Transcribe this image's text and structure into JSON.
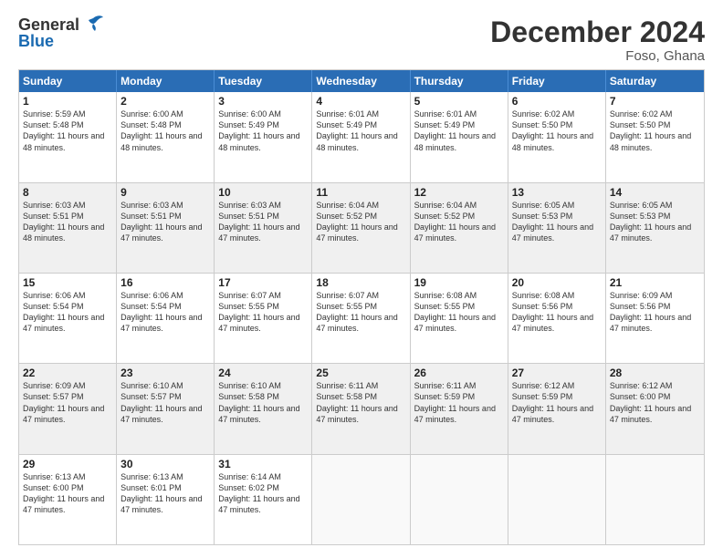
{
  "header": {
    "logo_general": "General",
    "logo_blue": "Blue",
    "month_title": "December 2024",
    "location": "Foso, Ghana"
  },
  "days_of_week": [
    "Sunday",
    "Monday",
    "Tuesday",
    "Wednesday",
    "Thursday",
    "Friday",
    "Saturday"
  ],
  "weeks": [
    [
      {
        "day": "1",
        "sunrise": "Sunrise: 5:59 AM",
        "sunset": "Sunset: 5:48 PM",
        "daylight": "Daylight: 11 hours and 48 minutes."
      },
      {
        "day": "2",
        "sunrise": "Sunrise: 6:00 AM",
        "sunset": "Sunset: 5:48 PM",
        "daylight": "Daylight: 11 hours and 48 minutes."
      },
      {
        "day": "3",
        "sunrise": "Sunrise: 6:00 AM",
        "sunset": "Sunset: 5:49 PM",
        "daylight": "Daylight: 11 hours and 48 minutes."
      },
      {
        "day": "4",
        "sunrise": "Sunrise: 6:01 AM",
        "sunset": "Sunset: 5:49 PM",
        "daylight": "Daylight: 11 hours and 48 minutes."
      },
      {
        "day": "5",
        "sunrise": "Sunrise: 6:01 AM",
        "sunset": "Sunset: 5:49 PM",
        "daylight": "Daylight: 11 hours and 48 minutes."
      },
      {
        "day": "6",
        "sunrise": "Sunrise: 6:02 AM",
        "sunset": "Sunset: 5:50 PM",
        "daylight": "Daylight: 11 hours and 48 minutes."
      },
      {
        "day": "7",
        "sunrise": "Sunrise: 6:02 AM",
        "sunset": "Sunset: 5:50 PM",
        "daylight": "Daylight: 11 hours and 48 minutes."
      }
    ],
    [
      {
        "day": "8",
        "sunrise": "Sunrise: 6:03 AM",
        "sunset": "Sunset: 5:51 PM",
        "daylight": "Daylight: 11 hours and 48 minutes."
      },
      {
        "day": "9",
        "sunrise": "Sunrise: 6:03 AM",
        "sunset": "Sunset: 5:51 PM",
        "daylight": "Daylight: 11 hours and 47 minutes."
      },
      {
        "day": "10",
        "sunrise": "Sunrise: 6:03 AM",
        "sunset": "Sunset: 5:51 PM",
        "daylight": "Daylight: 11 hours and 47 minutes."
      },
      {
        "day": "11",
        "sunrise": "Sunrise: 6:04 AM",
        "sunset": "Sunset: 5:52 PM",
        "daylight": "Daylight: 11 hours and 47 minutes."
      },
      {
        "day": "12",
        "sunrise": "Sunrise: 6:04 AM",
        "sunset": "Sunset: 5:52 PM",
        "daylight": "Daylight: 11 hours and 47 minutes."
      },
      {
        "day": "13",
        "sunrise": "Sunrise: 6:05 AM",
        "sunset": "Sunset: 5:53 PM",
        "daylight": "Daylight: 11 hours and 47 minutes."
      },
      {
        "day": "14",
        "sunrise": "Sunrise: 6:05 AM",
        "sunset": "Sunset: 5:53 PM",
        "daylight": "Daylight: 11 hours and 47 minutes."
      }
    ],
    [
      {
        "day": "15",
        "sunrise": "Sunrise: 6:06 AM",
        "sunset": "Sunset: 5:54 PM",
        "daylight": "Daylight: 11 hours and 47 minutes."
      },
      {
        "day": "16",
        "sunrise": "Sunrise: 6:06 AM",
        "sunset": "Sunset: 5:54 PM",
        "daylight": "Daylight: 11 hours and 47 minutes."
      },
      {
        "day": "17",
        "sunrise": "Sunrise: 6:07 AM",
        "sunset": "Sunset: 5:55 PM",
        "daylight": "Daylight: 11 hours and 47 minutes."
      },
      {
        "day": "18",
        "sunrise": "Sunrise: 6:07 AM",
        "sunset": "Sunset: 5:55 PM",
        "daylight": "Daylight: 11 hours and 47 minutes."
      },
      {
        "day": "19",
        "sunrise": "Sunrise: 6:08 AM",
        "sunset": "Sunset: 5:55 PM",
        "daylight": "Daylight: 11 hours and 47 minutes."
      },
      {
        "day": "20",
        "sunrise": "Sunrise: 6:08 AM",
        "sunset": "Sunset: 5:56 PM",
        "daylight": "Daylight: 11 hours and 47 minutes."
      },
      {
        "day": "21",
        "sunrise": "Sunrise: 6:09 AM",
        "sunset": "Sunset: 5:56 PM",
        "daylight": "Daylight: 11 hours and 47 minutes."
      }
    ],
    [
      {
        "day": "22",
        "sunrise": "Sunrise: 6:09 AM",
        "sunset": "Sunset: 5:57 PM",
        "daylight": "Daylight: 11 hours and 47 minutes."
      },
      {
        "day": "23",
        "sunrise": "Sunrise: 6:10 AM",
        "sunset": "Sunset: 5:57 PM",
        "daylight": "Daylight: 11 hours and 47 minutes."
      },
      {
        "day": "24",
        "sunrise": "Sunrise: 6:10 AM",
        "sunset": "Sunset: 5:58 PM",
        "daylight": "Daylight: 11 hours and 47 minutes."
      },
      {
        "day": "25",
        "sunrise": "Sunrise: 6:11 AM",
        "sunset": "Sunset: 5:58 PM",
        "daylight": "Daylight: 11 hours and 47 minutes."
      },
      {
        "day": "26",
        "sunrise": "Sunrise: 6:11 AM",
        "sunset": "Sunset: 5:59 PM",
        "daylight": "Daylight: 11 hours and 47 minutes."
      },
      {
        "day": "27",
        "sunrise": "Sunrise: 6:12 AM",
        "sunset": "Sunset: 5:59 PM",
        "daylight": "Daylight: 11 hours and 47 minutes."
      },
      {
        "day": "28",
        "sunrise": "Sunrise: 6:12 AM",
        "sunset": "Sunset: 6:00 PM",
        "daylight": "Daylight: 11 hours and 47 minutes."
      }
    ],
    [
      {
        "day": "29",
        "sunrise": "Sunrise: 6:13 AM",
        "sunset": "Sunset: 6:00 PM",
        "daylight": "Daylight: 11 hours and 47 minutes."
      },
      {
        "day": "30",
        "sunrise": "Sunrise: 6:13 AM",
        "sunset": "Sunset: 6:01 PM",
        "daylight": "Daylight: 11 hours and 47 minutes."
      },
      {
        "day": "31",
        "sunrise": "Sunrise: 6:14 AM",
        "sunset": "Sunset: 6:02 PM",
        "daylight": "Daylight: 11 hours and 47 minutes."
      },
      {
        "day": "",
        "sunrise": "",
        "sunset": "",
        "daylight": ""
      },
      {
        "day": "",
        "sunrise": "",
        "sunset": "",
        "daylight": ""
      },
      {
        "day": "",
        "sunrise": "",
        "sunset": "",
        "daylight": ""
      },
      {
        "day": "",
        "sunrise": "",
        "sunset": "",
        "daylight": ""
      }
    ]
  ]
}
